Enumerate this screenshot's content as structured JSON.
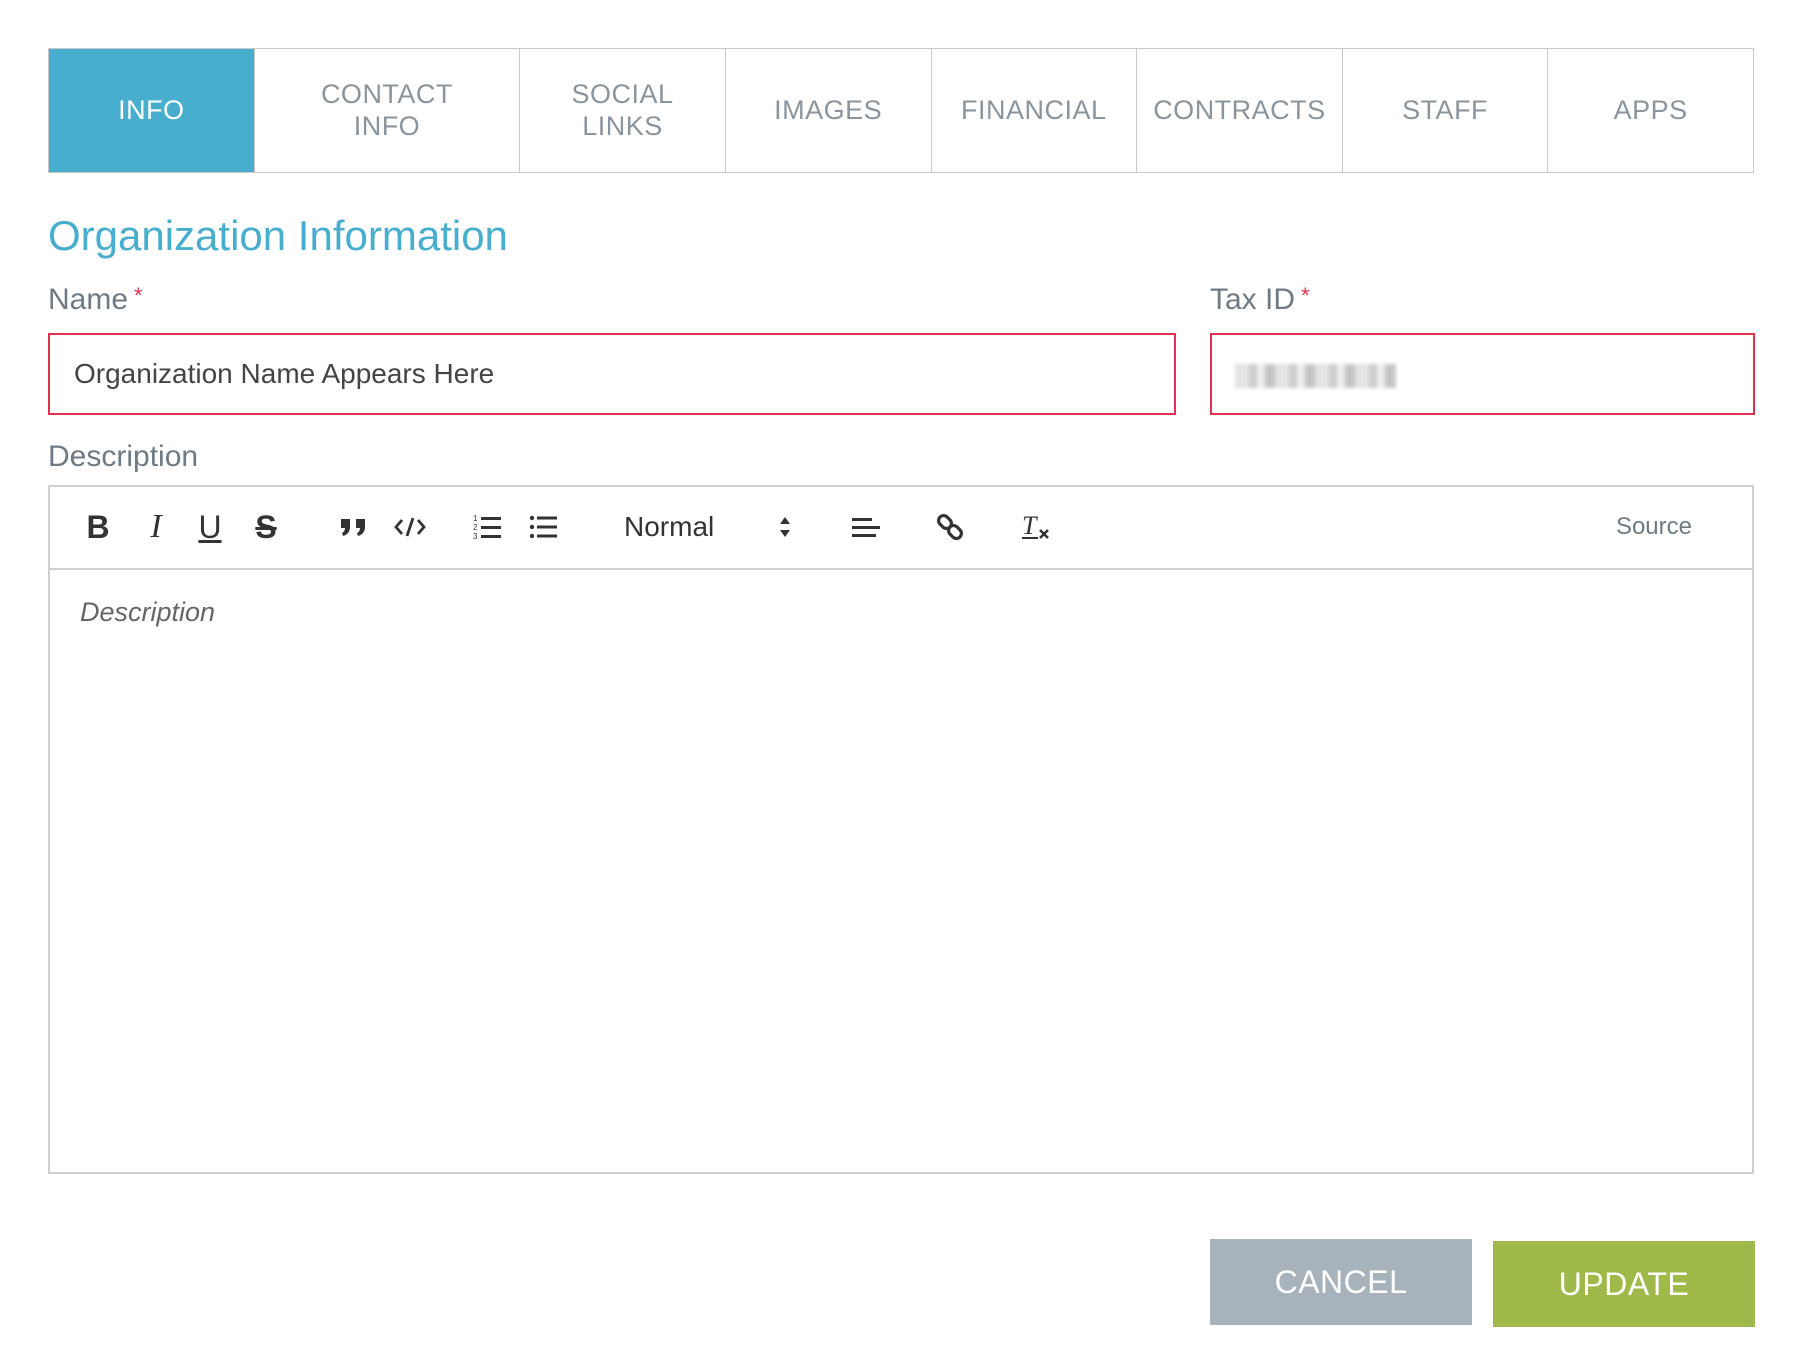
{
  "tabs": [
    {
      "label": "INFO",
      "active": true
    },
    {
      "label": "CONTACT INFO",
      "active": false
    },
    {
      "label": "SOCIAL LINKS",
      "active": false
    },
    {
      "label": "IMAGES",
      "active": false
    },
    {
      "label": "FINANCIAL",
      "active": false
    },
    {
      "label": "CONTRACTS",
      "active": false
    },
    {
      "label": "STAFF",
      "active": false
    },
    {
      "label": "APPS",
      "active": false
    }
  ],
  "section_title": "Organization Information",
  "fields": {
    "name": {
      "label": "Name",
      "required_mark": "*",
      "value": "Organization Name Appears Here"
    },
    "tax_id": {
      "label": "Tax ID",
      "required_mark": "*"
    },
    "description": {
      "label": "Description",
      "placeholder": "Description"
    }
  },
  "editor": {
    "toolbar": {
      "bold": "B",
      "italic": "I",
      "underline": "U",
      "strike": "S",
      "heading_select": "Normal",
      "source": "Source"
    },
    "icons": [
      "bold-icon",
      "italic-icon",
      "underline-icon",
      "strike-icon",
      "quote-icon",
      "code-icon",
      "ordered-list-icon",
      "bullet-list-icon",
      "select-arrows-icon",
      "align-left-icon",
      "link-icon",
      "clear-format-icon"
    ]
  },
  "buttons": {
    "cancel": "CANCEL",
    "update": "UPDATE"
  },
  "colors": {
    "accent": "#47aece",
    "required": "#e0314f",
    "update": "#9fba4a",
    "cancel": "#a8b2ba"
  }
}
